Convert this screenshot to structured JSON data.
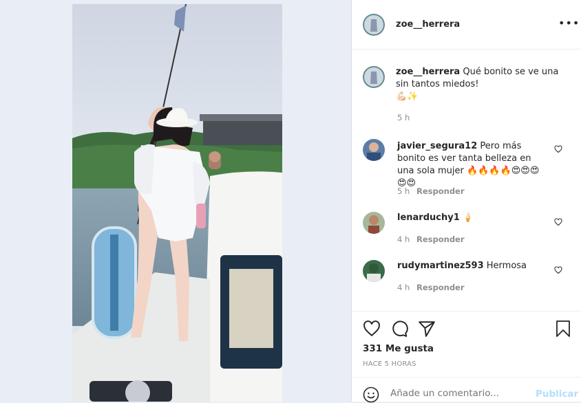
{
  "post": {
    "username": "zoe__herrera",
    "caption": "Qué bonito se ve una sin tantos miedos!",
    "caption_emoji": "💪🏻✨",
    "caption_time": "5 h"
  },
  "comments": [
    {
      "username": "javier_segura12",
      "text": "Pero más bonito es ver tanta belleza en una sola mujer 🔥🔥🔥🔥😍😍😍😍😍",
      "time": "5 h",
      "reply": "Responder"
    },
    {
      "username": "lenarduchy1",
      "text": "🍦",
      "time": "4 h",
      "reply": "Responder"
    },
    {
      "username": "rudymartinez593",
      "text": "Hermosa",
      "time": "4 h",
      "reply": "Responder"
    }
  ],
  "stats": {
    "likes": "331 Me gusta",
    "posted": "HACE 5 HORAS"
  },
  "comment_box": {
    "placeholder": "Añade un comentario...",
    "publish": "Publicar"
  },
  "colors": {
    "accent": "#0095f6",
    "text": "#262626",
    "muted": "#8e8e8e"
  }
}
